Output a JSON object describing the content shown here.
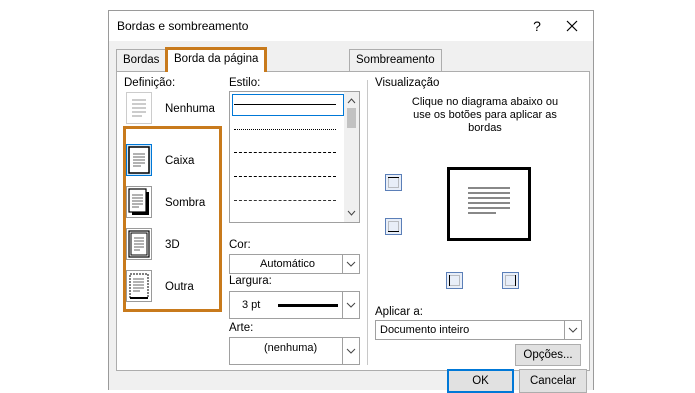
{
  "dialog": {
    "title": "Bordas e sombreamento",
    "help_label": "?",
    "tabs": [
      {
        "label": "Bordas",
        "active": false
      },
      {
        "label": "Borda da página",
        "active": true
      },
      {
        "label": "Sombreamento",
        "active": false
      }
    ]
  },
  "setting": {
    "label": "Definição:",
    "options": [
      {
        "label": "Nenhuma",
        "icon": "none-border-icon"
      },
      {
        "label": "Caixa",
        "icon": "box-border-icon",
        "selected": true
      },
      {
        "label": "Sombra",
        "icon": "shadow-border-icon"
      },
      {
        "label": "3D",
        "icon": "3d-border-icon"
      },
      {
        "label": "Outra",
        "icon": "custom-border-icon"
      }
    ]
  },
  "style": {
    "label": "Estilo:",
    "lines": [
      "solid",
      "dotted",
      "dashed-small",
      "dashed",
      "dash-dot"
    ]
  },
  "color": {
    "label": "Cor:",
    "value": "Automático"
  },
  "width": {
    "label": "Largura:",
    "value": "3 pt"
  },
  "art": {
    "label": "Arte:",
    "value": "(nenhuma)"
  },
  "preview": {
    "label": "Visualização",
    "instructions": "Clique no diagrama abaixo ou use os botões para aplicar as bordas"
  },
  "apply": {
    "label": "Aplicar a:",
    "value": "Documento inteiro"
  },
  "buttons": {
    "options": "Opções...",
    "ok": "OK",
    "cancel": "Cancelar"
  },
  "colors": {
    "highlight": "#c87a1c",
    "accent": "#0078d7"
  }
}
